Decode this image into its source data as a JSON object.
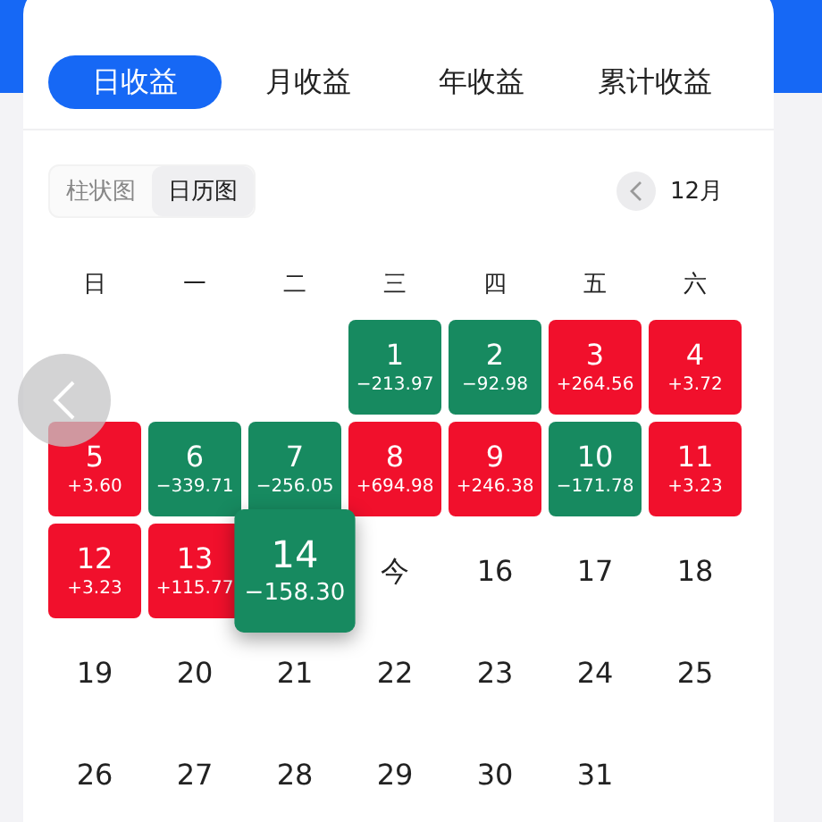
{
  "tabs": [
    {
      "label": "日收益",
      "selected": true
    },
    {
      "label": "月收益",
      "selected": false
    },
    {
      "label": "年收益",
      "selected": false
    },
    {
      "label": "累计收益",
      "selected": false
    }
  ],
  "view_toggle": [
    {
      "label": "柱状图",
      "selected": false
    },
    {
      "label": "日历图",
      "selected": true
    }
  ],
  "month": {
    "label": "12月"
  },
  "weekdays": [
    "日",
    "一",
    "二",
    "三",
    "四",
    "五",
    "六"
  ],
  "days": [
    {
      "kind": "blank"
    },
    {
      "kind": "blank"
    },
    {
      "kind": "blank"
    },
    {
      "kind": "loss",
      "day": "1",
      "value": "−213.97",
      "selected": false
    },
    {
      "kind": "loss",
      "day": "2",
      "value": "−92.98",
      "selected": false
    },
    {
      "kind": "gain",
      "day": "3",
      "value": "+264.56",
      "selected": false
    },
    {
      "kind": "gain",
      "day": "4",
      "value": "+3.72",
      "selected": false
    },
    {
      "kind": "gain",
      "day": "5",
      "value": "+3.60",
      "selected": false
    },
    {
      "kind": "loss",
      "day": "6",
      "value": "−339.71",
      "selected": false
    },
    {
      "kind": "loss",
      "day": "7",
      "value": "−256.05",
      "selected": false
    },
    {
      "kind": "gain",
      "day": "8",
      "value": "+694.98",
      "selected": false
    },
    {
      "kind": "gain",
      "day": "9",
      "value": "+246.38",
      "selected": false
    },
    {
      "kind": "loss",
      "day": "10",
      "value": "−171.78",
      "selected": false
    },
    {
      "kind": "gain",
      "day": "11",
      "value": "+3.23",
      "selected": false
    },
    {
      "kind": "gain",
      "day": "12",
      "value": "+3.23",
      "selected": false
    },
    {
      "kind": "gain",
      "day": "13",
      "value": "+115.77",
      "selected": false
    },
    {
      "kind": "loss",
      "day": "14",
      "value": "−158.30",
      "selected": true
    },
    {
      "kind": "plain",
      "day": "今",
      "selected": false
    },
    {
      "kind": "plain",
      "day": "16",
      "selected": false
    },
    {
      "kind": "plain",
      "day": "17",
      "selected": false
    },
    {
      "kind": "plain",
      "day": "18",
      "selected": false
    },
    {
      "kind": "plain",
      "day": "19",
      "selected": false
    },
    {
      "kind": "plain",
      "day": "20",
      "selected": false
    },
    {
      "kind": "plain",
      "day": "21",
      "selected": false
    },
    {
      "kind": "plain",
      "day": "22",
      "selected": false
    },
    {
      "kind": "plain",
      "day": "23",
      "selected": false
    },
    {
      "kind": "plain",
      "day": "24",
      "selected": false
    },
    {
      "kind": "plain",
      "day": "25",
      "selected": false
    },
    {
      "kind": "plain",
      "day": "26",
      "selected": false
    },
    {
      "kind": "plain",
      "day": "27",
      "selected": false
    },
    {
      "kind": "plain",
      "day": "28",
      "selected": false
    },
    {
      "kind": "plain",
      "day": "29",
      "selected": false
    },
    {
      "kind": "plain",
      "day": "30",
      "selected": false
    },
    {
      "kind": "plain",
      "day": "31",
      "selected": false
    }
  ]
}
